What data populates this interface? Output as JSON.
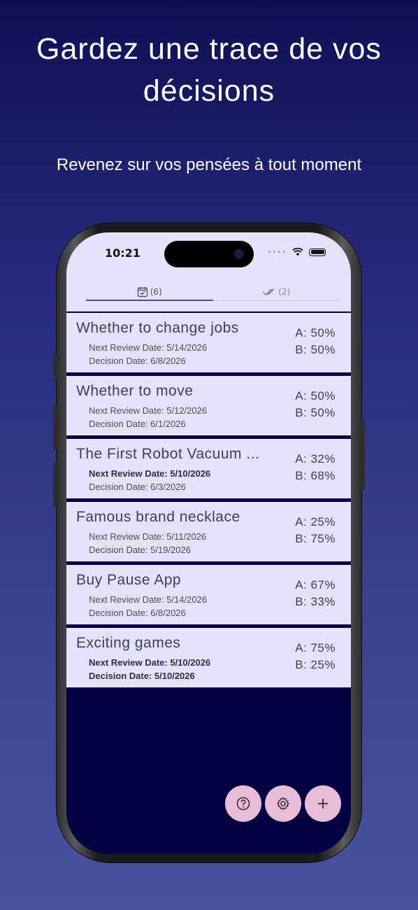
{
  "hero": {
    "headline": "Gardez une trace de vos décisions",
    "subline": "Revenez sur vos pensées à tout moment"
  },
  "status_bar": {
    "time": "10:21"
  },
  "tabs": [
    {
      "icon": "calendar-check-icon",
      "count": "(6)",
      "active": true
    },
    {
      "icon": "double-check-icon",
      "count": "(2)",
      "active": false
    }
  ],
  "decisions": [
    {
      "title": "Whether to change jobs",
      "next_review": "Next Review Date: 5/14/2026",
      "decision_date": "Decision Date: 6/8/2026",
      "a": "A: 50%",
      "b": "B: 50%",
      "highlight": false
    },
    {
      "title": "Whether to move",
      "next_review": "Next Review Date: 5/12/2026",
      "decision_date": "Decision Date: 6/1/2026",
      "a": "A: 50%",
      "b": "B: 50%",
      "highlight": false
    },
    {
      "title": "The First Robot Vacuum ...",
      "next_review": "Next Review Date: 5/10/2026",
      "decision_date": "Decision Date: 6/3/2026",
      "a": "A: 32%",
      "b": "B: 68%",
      "highlight": "review"
    },
    {
      "title": "Famous brand necklace",
      "next_review": "Next Review Date: 5/11/2026",
      "decision_date": "Decision Date: 5/19/2026",
      "a": "A: 25%",
      "b": "B: 75%",
      "highlight": false
    },
    {
      "title": "Buy Pause App",
      "next_review": "Next Review Date: 5/14/2026",
      "decision_date": "Decision Date: 6/8/2026",
      "a": "A: 67%",
      "b": "B: 33%",
      "highlight": false
    },
    {
      "title": "Exciting games",
      "next_review": "Next Review Date: 5/10/2026",
      "decision_date": "Decision Date: 5/10/2026",
      "a": "A: 75%",
      "b": "B: 25%",
      "highlight": "both"
    }
  ],
  "fabs": [
    {
      "icon": "help-circle-icon",
      "glyph": "?"
    },
    {
      "icon": "gear-icon",
      "glyph": "⚙"
    },
    {
      "icon": "plus-icon",
      "glyph": "+"
    }
  ],
  "colors": {
    "card_bg": "#e5e2fc",
    "screen_bg": "#030344",
    "fab_bg": "#e9bdd8",
    "text": "#3b3e66"
  }
}
